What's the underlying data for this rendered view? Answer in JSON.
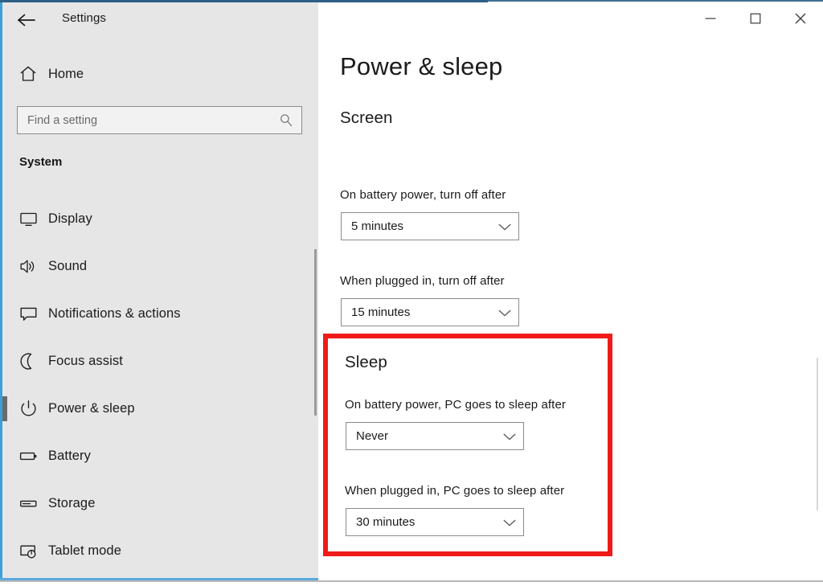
{
  "window": {
    "title": "Settings",
    "back_icon": "back-arrow-icon",
    "minimize_label": "─",
    "maximize_label": "□",
    "close_label": "✕"
  },
  "sidebar": {
    "home": {
      "label": "Home",
      "icon": "home-icon"
    },
    "search": {
      "placeholder": "Find a setting",
      "value": "",
      "icon": "search-icon"
    },
    "group_title": "System",
    "items": [
      {
        "label": "Display",
        "icon": "monitor-icon",
        "selected": false
      },
      {
        "label": "Sound",
        "icon": "speaker-icon",
        "selected": false
      },
      {
        "label": "Notifications & actions",
        "icon": "chat-bubble-icon",
        "selected": false
      },
      {
        "label": "Focus assist",
        "icon": "moon-icon",
        "selected": false
      },
      {
        "label": "Power & sleep",
        "icon": "power-icon",
        "selected": true
      },
      {
        "label": "Battery",
        "icon": "battery-icon",
        "selected": false
      },
      {
        "label": "Storage",
        "icon": "storage-icon",
        "selected": false
      },
      {
        "label": "Tablet mode",
        "icon": "tablet-mode-icon",
        "selected": false
      }
    ]
  },
  "main": {
    "page_title": "Power & sleep",
    "screen_section": {
      "heading": "Screen",
      "battery_label": "On battery power, turn off after",
      "battery_value": "5 minutes",
      "plugged_label": "When plugged in, turn off after",
      "plugged_value": "15 minutes"
    },
    "sleep_section": {
      "heading": "Sleep",
      "battery_label": "On battery power, PC goes to sleep after",
      "battery_value": "Never",
      "plugged_label": "When plugged in, PC goes to sleep after",
      "plugged_value": "30 minutes",
      "highlight_color": "#ee1b19"
    }
  },
  "colors": {
    "sidebar_bg": "#e6e6e6",
    "content_bg": "#ffffff",
    "text": "#1b1b1b",
    "selection_bar": "#6b6b6b",
    "accent_line": "#3e9fd8"
  }
}
